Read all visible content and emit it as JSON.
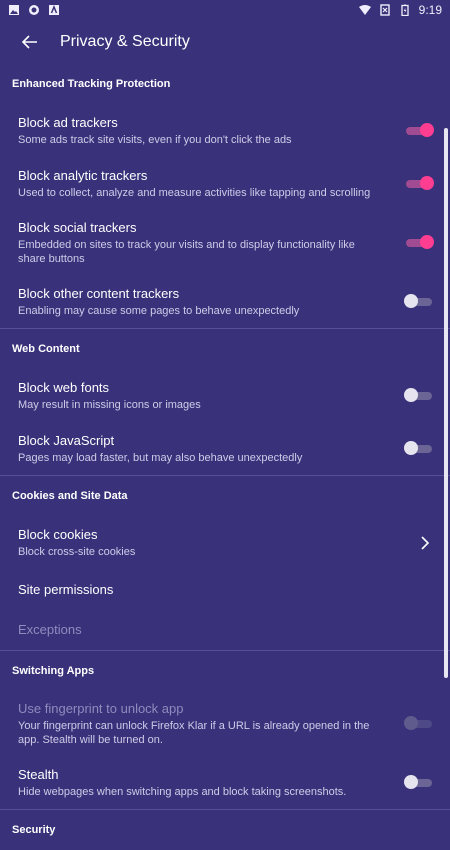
{
  "status_bar": {
    "time": "9:19",
    "left_icons": [
      "image-icon",
      "firefox-icon",
      "a-icon"
    ],
    "right_icons": [
      "wifi-icon",
      "sim-icon",
      "battery-icon"
    ]
  },
  "header": {
    "title": "Privacy & Security"
  },
  "sections": {
    "etp": "Enhanced Tracking Protection",
    "web": "Web Content",
    "cookies": "Cookies and Site Data",
    "switching": "Switching Apps",
    "security": "Security"
  },
  "rows": {
    "ad": {
      "title": "Block ad trackers",
      "subtitle": "Some ads track site visits, even if you don't click the ads",
      "state": "on"
    },
    "analytic": {
      "title": "Block analytic trackers",
      "subtitle": "Used to collect, analyze and measure activities like tapping and scrolling",
      "state": "on"
    },
    "social": {
      "title": "Block social trackers",
      "subtitle": "Embedded on sites to track your visits and to display functionality like share buttons",
      "state": "on"
    },
    "other": {
      "title": "Block other content trackers",
      "subtitle": "Enabling may cause some pages to behave unexpectedly",
      "state": "off"
    },
    "fonts": {
      "title": "Block web fonts",
      "subtitle": "May result in missing icons or images",
      "state": "off"
    },
    "js": {
      "title": "Block JavaScript",
      "subtitle": "Pages may load faster, but may also behave unexpectedly",
      "state": "off"
    },
    "cookies": {
      "title": "Block cookies",
      "subtitle": "Block cross-site cookies"
    },
    "permissions": {
      "title": "Site permissions"
    },
    "exceptions": {
      "title": "Exceptions"
    },
    "fingerprint": {
      "title": "Use fingerprint to unlock app",
      "subtitle": "Your fingerprint can unlock Firefox Klar if a URL is already opened in the app. Stealth will be turned on.",
      "state": "disabled"
    },
    "stealth": {
      "title": "Stealth",
      "subtitle": "Hide webpages when switching apps and block taking screenshots.",
      "state": "off"
    }
  },
  "colors": {
    "background": "#39327a",
    "accent": "#ff3e91"
  }
}
